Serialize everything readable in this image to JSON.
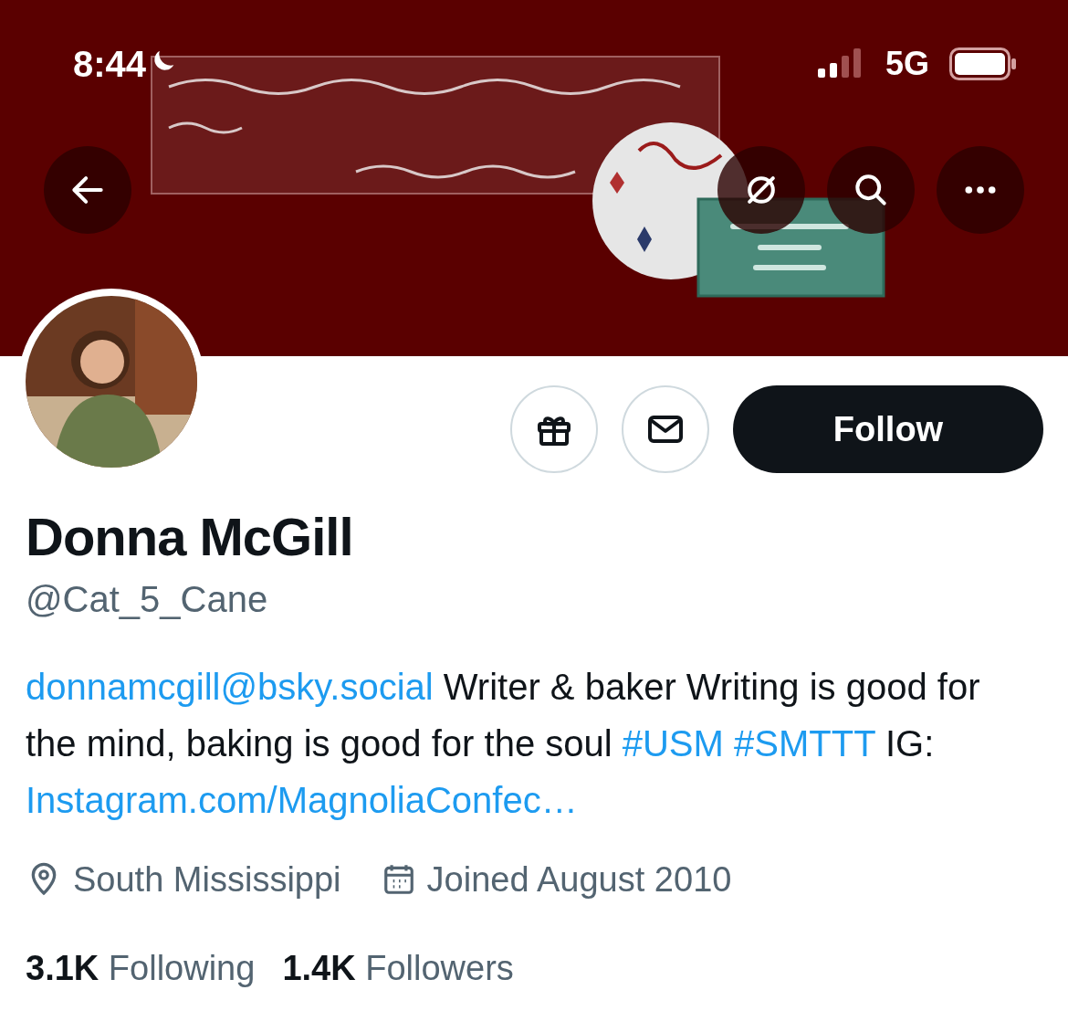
{
  "status_bar": {
    "time": "8:44",
    "do_not_disturb": true,
    "network": "5G"
  },
  "nav": {
    "buttons": [
      {
        "kind": "back"
      },
      {
        "kind": "grok"
      },
      {
        "kind": "search"
      },
      {
        "kind": "more"
      }
    ]
  },
  "actions": [
    {
      "kind": "gift"
    },
    {
      "kind": "message"
    }
  ],
  "follow_button": "Follow",
  "profile": {
    "name": "Donna McGill",
    "handle": "@Cat_5_Cane",
    "bio": [
      {
        "kind": "link",
        "text": "donnamcgill@bsky.social"
      },
      {
        "kind": "text",
        "text": " Writer & baker Writing is good for the mind, baking is good for the soul "
      },
      {
        "kind": "link",
        "text": "#USM"
      },
      {
        "kind": "link",
        "text": "#SMTTT"
      },
      {
        "kind": "text",
        "text": " IG: "
      },
      {
        "kind": "link",
        "text": "Instagram.com/MagnoliaConfec…"
      }
    ],
    "location": "South Mississippi",
    "joined": "Joined August 2010"
  },
  "stats": [
    {
      "count": "3.1K",
      "label": "Following"
    },
    {
      "count": "1.4K",
      "label": "Followers"
    }
  ]
}
